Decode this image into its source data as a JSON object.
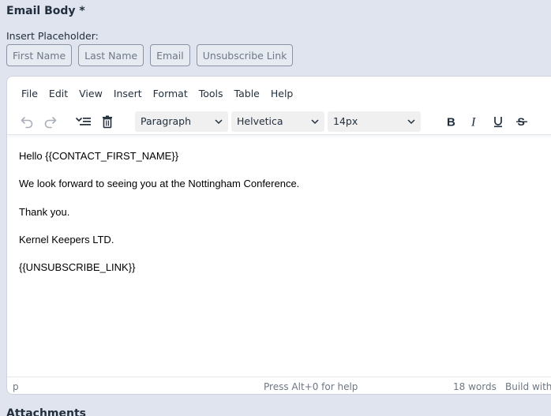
{
  "email_body": {
    "label": "Email Body *",
    "insert_placeholder_label": "Insert Placeholder:",
    "placeholders": [
      "First Name",
      "Last Name",
      "Email",
      "Unsubscribe Link"
    ]
  },
  "editor": {
    "menu": [
      "File",
      "Edit",
      "View",
      "Insert",
      "Format",
      "Tools",
      "Table",
      "Help"
    ],
    "toolbar": {
      "icons": [
        "undo-icon",
        "redo-icon",
        "text-direction-icon",
        "trash-icon"
      ],
      "block_format": "Paragraph",
      "font_family": "Helvetica",
      "font_size": "14px",
      "format_icons": [
        "bold-icon",
        "italic-icon",
        "underline-icon",
        "strikethrough-icon"
      ]
    },
    "content": [
      "Hello {{CONTACT_FIRST_NAME}}",
      "We look forward to seeing you at the Nottingham Conference.",
      "Thank you.",
      "Kernel Keepers LTD.",
      "{{UNSUBSCRIBE_LINK}}"
    ],
    "status": {
      "path": "p",
      "help": "Press Alt+0 for help",
      "word_count": "18 words",
      "branding": "Build with"
    }
  },
  "attachments": {
    "label": "Attachments"
  }
}
